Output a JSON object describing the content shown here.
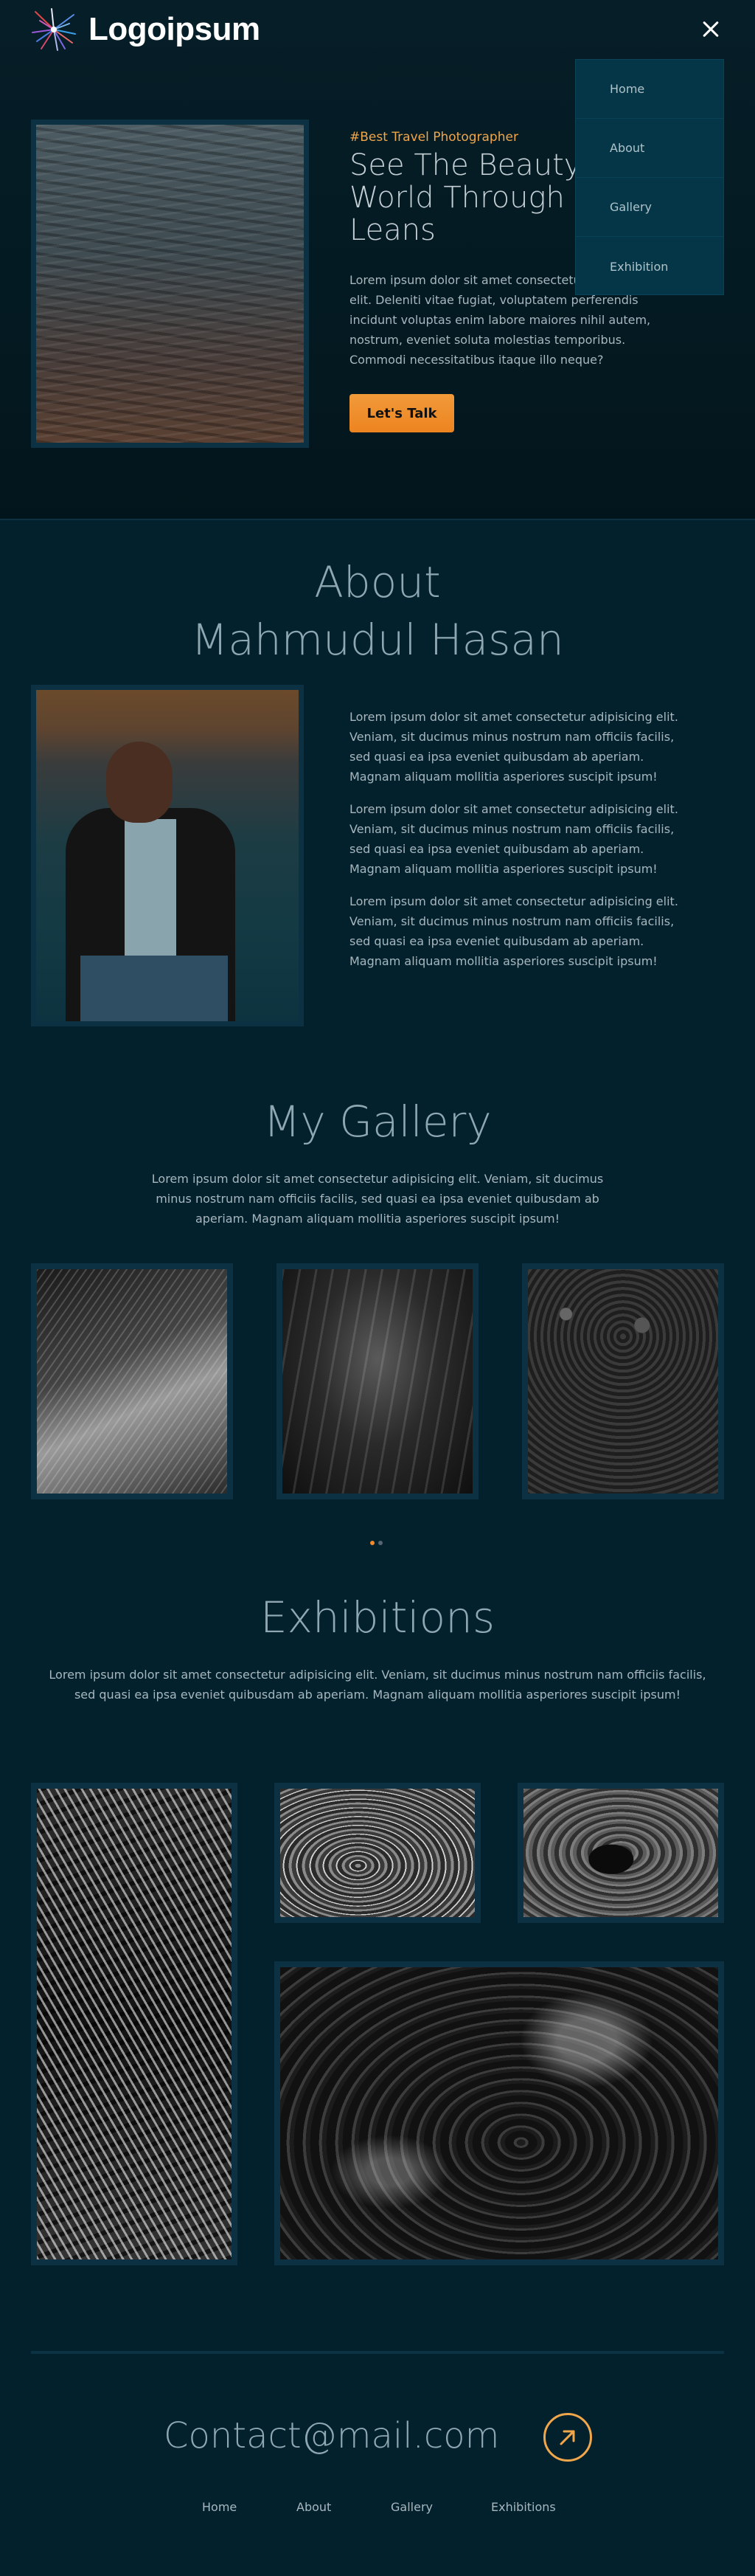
{
  "header": {
    "logo_text": "Logoipsum",
    "logo_icon": "starburst-logo-icon",
    "close_icon": "close-icon"
  },
  "nav_menu": {
    "items": [
      "Home",
      "About",
      "Gallery",
      "Exhibition"
    ]
  },
  "hero": {
    "tag": "#Best Travel Photographer",
    "title": "See The Beauty Of World Through My Leans",
    "body": "Lorem ipsum dolor sit amet consectetur adipisicing elit. Deleniti vitae fugiat, voluptatem perferendis incidunt voluptas enim labore maiores nihil autem, nostrum, eveniet soluta molestias temporibus. Commodi necessitatibus itaque illo neque?",
    "cta_label": "Let's Talk"
  },
  "about": {
    "title_line1": "About",
    "title_line2": "Mahmudul Hasan",
    "paragraphs": [
      "Lorem ipsum dolor sit amet consectetur adipisicing elit. Veniam, sit ducimus minus nostrum nam officiis facilis, sed quasi ea ipsa eveniet quibusdam ab aperiam. Magnam aliquam mollitia asperiores suscipit ipsum!",
      "Lorem ipsum dolor sit amet consectetur adipisicing elit. Veniam, sit ducimus minus nostrum nam officiis facilis, sed quasi ea ipsa eveniet quibusdam ab aperiam. Magnam aliquam mollitia asperiores suscipit ipsum!",
      "Lorem ipsum dolor sit amet consectetur adipisicing elit. Veniam, sit ducimus minus nostrum nam officiis facilis, sed quasi ea ipsa eveniet quibusdam ab aperiam. Magnam aliquam mollitia asperiores suscipit ipsum!"
    ]
  },
  "gallery": {
    "title": "My Gallery",
    "description": "Lorem ipsum dolor sit amet consectetur adipisicing elit. Veniam, sit ducimus minus nostrum nam officiis facilis, sed quasi ea ipsa eveniet quibusdam ab aperiam. Magnam aliquam mollitia asperiores suscipit ipsum!",
    "active_slide": 1,
    "slide_count": 2
  },
  "exhibitions": {
    "title": "Exhibitions",
    "description": "Lorem ipsum dolor sit amet consectetur adipisicing elit. Veniam, sit ducimus minus nostrum nam officiis facilis, sed quasi ea ipsa eveniet quibusdam ab aperiam. Magnam aliquam mollitia asperiores suscipit ipsum!"
  },
  "footer": {
    "contact": "Contact@mail.com",
    "arrow_icon": "arrow-up-right-icon",
    "nav": [
      "Home",
      "About",
      "Gallery",
      "Exhibitions"
    ]
  },
  "colors": {
    "background": "#02212d",
    "accent": "#f08a2c",
    "frame": "#0c3142"
  }
}
